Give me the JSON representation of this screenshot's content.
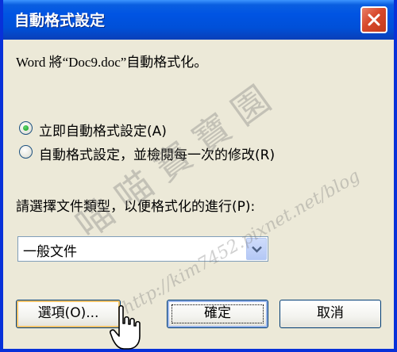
{
  "dialog": {
    "title": "自動格式設定",
    "message": "Word 將“Doc9.doc”自動格式化。",
    "options": [
      {
        "label": "立即自動格式設定(A)",
        "selected": true
      },
      {
        "label": "自動格式設定，並檢閱每一次的修改(R)",
        "selected": false
      }
    ],
    "doc_type_label": "請選擇文件類型，以便格式化的進行(P):",
    "doc_type_value": "一般文件",
    "buttons": {
      "options": "選項(O)...",
      "ok": "確定",
      "cancel": "取消"
    }
  },
  "watermark": {
    "chars": "喵 喵 寶 寶 園",
    "url": "http://kim7452.pixnet.net/blog"
  },
  "colors": {
    "titlebar": "#0054e3",
    "dialog_bg": "#ece9d8",
    "close_button": "#d7482b"
  }
}
